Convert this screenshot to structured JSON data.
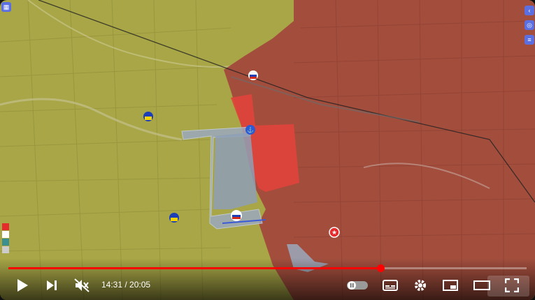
{
  "video": {
    "current_time": "14:31",
    "separator": " / ",
    "duration": "20:05",
    "progress": 0.718
  },
  "map": {
    "colors": {
      "ukraine_controlled": "#a8a646",
      "russia_controlled": "#a3463d",
      "recent_russian_advance": "#e0443a",
      "contested": "#9aa9bd",
      "progress_red": "#ff0000"
    },
    "markers": [
      {
        "type": "russian-flag",
        "label": ""
      },
      {
        "type": "ukrainian-flag",
        "label": ""
      },
      {
        "type": "ukrainian-flag",
        "label": ""
      },
      {
        "type": "ukrainian-flag",
        "label": ""
      },
      {
        "type": "russian-flag",
        "label": ""
      },
      {
        "type": "star",
        "label": ""
      }
    ],
    "side_buttons": [
      "arrow-left-icon",
      "globe-icon",
      "menu-icon"
    ],
    "top_left_button": "layers-icon"
  },
  "player": {
    "buttons": [
      "play-icon",
      "next-icon",
      "mute-icon",
      "autoplay-toggle",
      "subtitles-icon",
      "settings-icon",
      "miniplayer-icon",
      "theater-icon",
      "fullscreen-icon"
    ],
    "end_card_hint": "..."
  }
}
